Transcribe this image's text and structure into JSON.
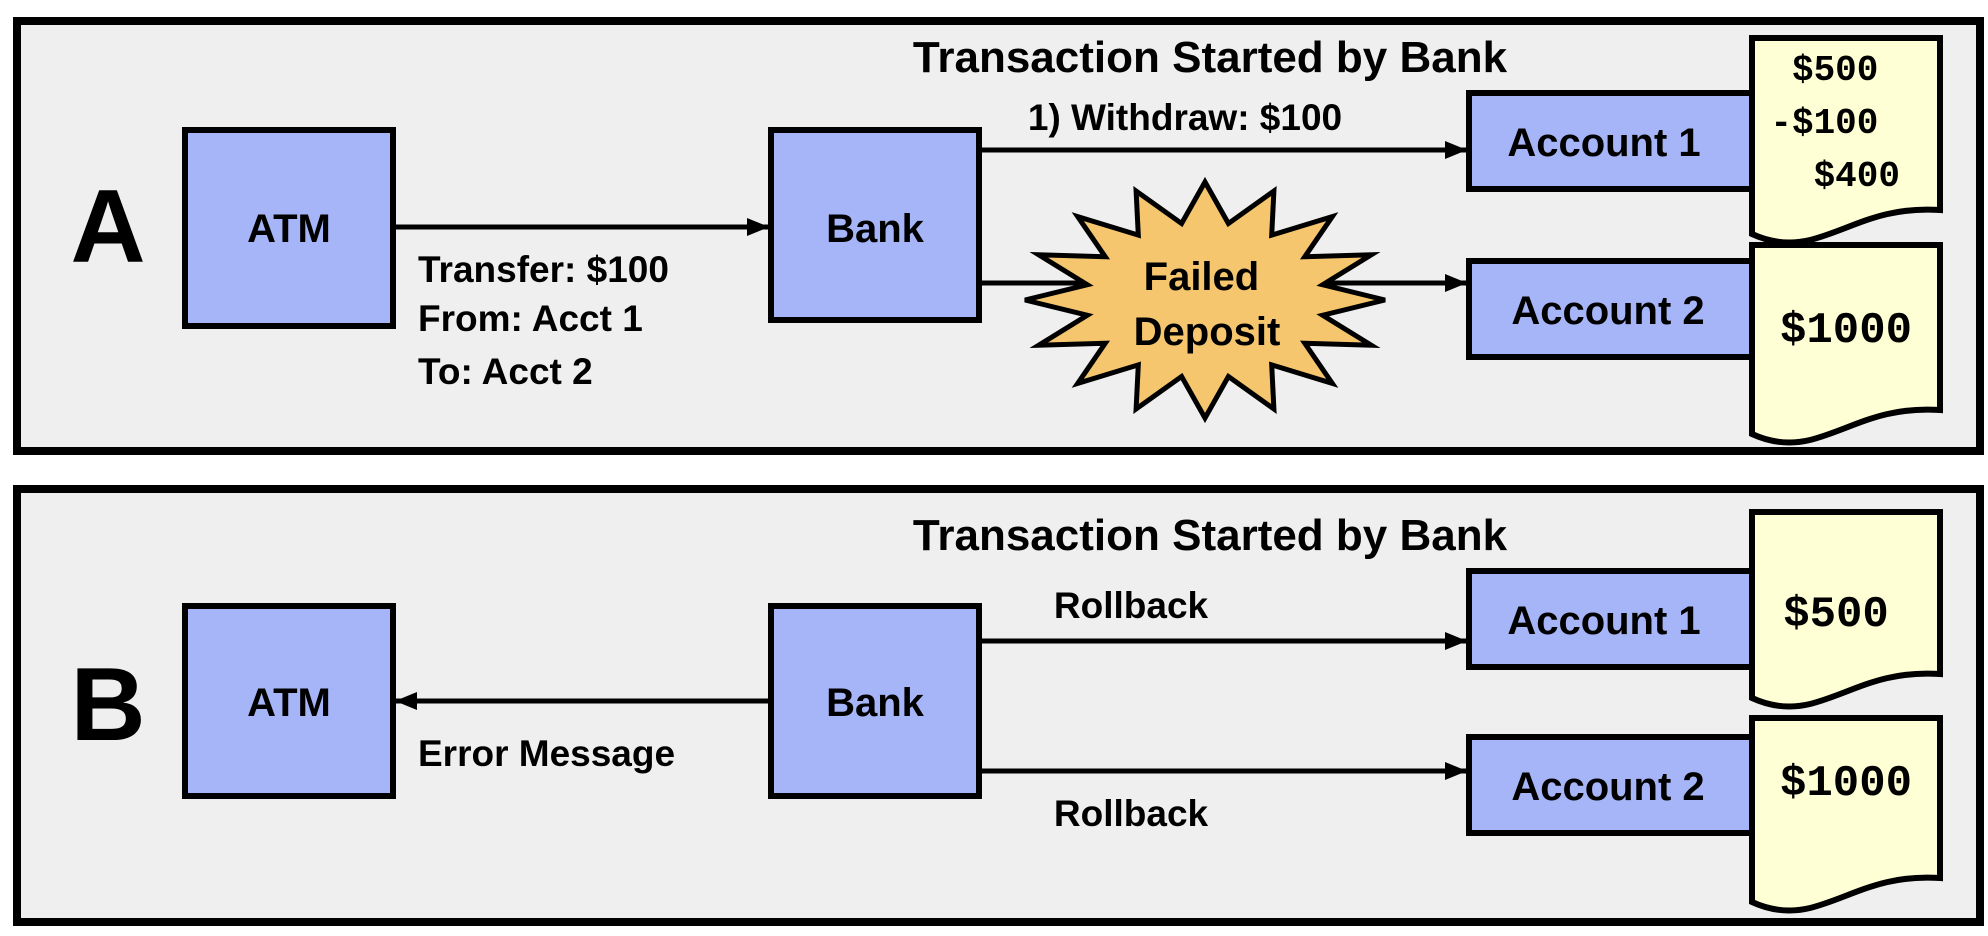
{
  "colors": {
    "panel_bg": "#efefef",
    "box_fill": "#a6b5f7",
    "doc_fill": "#ffffd5",
    "burst_fill": "#f5c66e",
    "stroke": "#000000"
  },
  "panel_a": {
    "letter": "A",
    "title": "Transaction Started by Bank",
    "atm": "ATM",
    "bank": "Bank",
    "account1": "Account 1",
    "account2": "Account 2",
    "withdraw_label": "1) Withdraw: $100",
    "transfer_lines": [
      "Transfer: $100",
      "From: Acct 1",
      "To: Acct 2"
    ],
    "failure_lines": [
      "Failed",
      "Deposit"
    ],
    "account1_ledger": [
      "$500",
      "-$100",
      "$400"
    ],
    "account2_ledger": "$1000"
  },
  "panel_b": {
    "letter": "B",
    "title": "Transaction Started by Bank",
    "atm": "ATM",
    "bank": "Bank",
    "account1": "Account 1",
    "account2": "Account 2",
    "rollback1": "Rollback",
    "rollback2": "Rollback",
    "error_label": "Error Message",
    "account1_ledger": "$500",
    "account2_ledger": "$1000"
  }
}
